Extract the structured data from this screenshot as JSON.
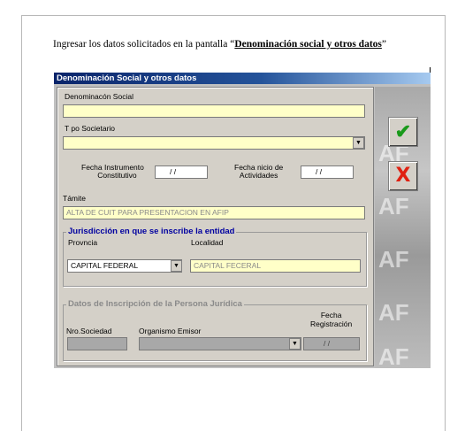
{
  "instruction": {
    "prefix": "Ingresar los datos solicitados en la pantalla “",
    "emphasis": "Denominación social y otros datos",
    "suffix": "”"
  },
  "dialog": {
    "title": "Denominación Social y otros datos",
    "denominacion_label": "Denominacón Social",
    "denominacion_value": "",
    "tipo_label": "T po Societario",
    "tipo_value": "",
    "fecha_instr_label_1": "Fecha Instrumento",
    "fecha_instr_label_2": "Constitutivo",
    "fecha_instr_value": "/ /",
    "fecha_inicio_label_1": "Fecha nicio de",
    "fecha_inicio_label_2": "Actividades",
    "fecha_inicio_value": "/ /",
    "tramite_label": "Támite",
    "tramite_value": "ALTA DE CUIT PARA PRESENTACION EN AFIP",
    "jurisdiccion": {
      "title": "Jurisdicción en que se inscribe la entidad",
      "provincia_label": "Provncia",
      "provincia_value": "CAPITAL FEDERAL",
      "localidad_label": "Localidad",
      "localidad_value": "CAPITAL FECERAL"
    },
    "inscripcion": {
      "title": "Datos de Inscripción de la Persona Jurídica",
      "nro_label": "Nro.Sociedad",
      "organismo_label": "Organismo Emisor",
      "fecha_label_1": "Fecha",
      "fecha_label_2": "Registración",
      "fecha_value": "/ /"
    },
    "ok_glyph": "✔",
    "cancel_glyph": "X"
  },
  "icons": {
    "confirm": "check-icon",
    "cancel": "x-icon",
    "dropdown": "chevron-down-icon"
  },
  "colors": {
    "title_start": "#0a246a",
    "title_end": "#a6caf0",
    "input_bg": "#ffffc8",
    "confirm": "#1a9a1a",
    "cancel": "#e02010",
    "group_title": "#0000a0"
  }
}
